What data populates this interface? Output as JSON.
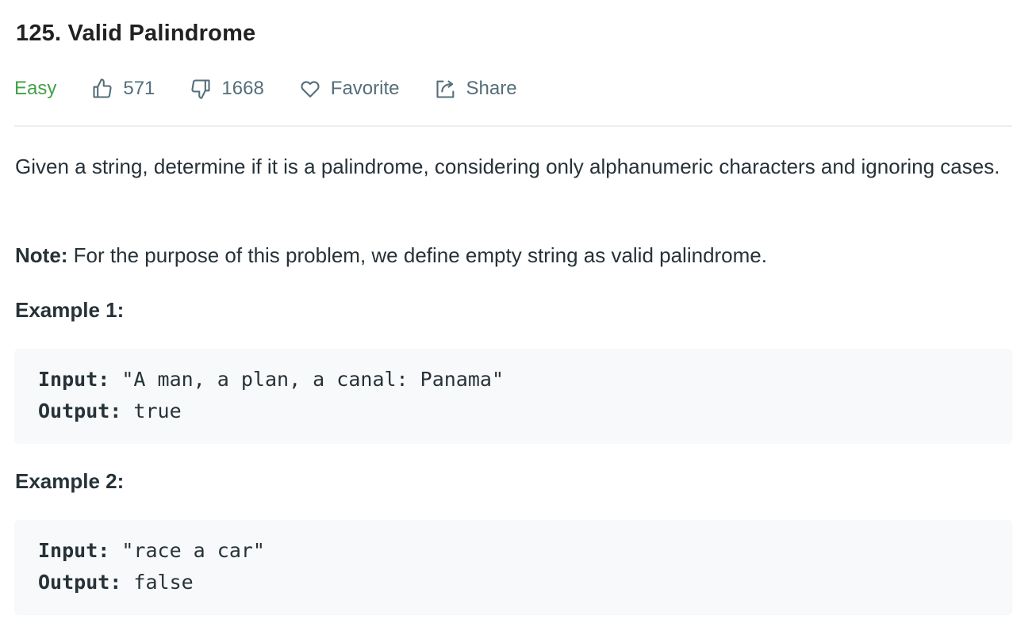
{
  "problem": {
    "title": "125. Valid Palindrome",
    "difficulty": "Easy",
    "likes": "571",
    "dislikes": "1668",
    "favorite_label": "Favorite",
    "share_label": "Share"
  },
  "description": {
    "text": "Given a string, determine if it is a palindrome, considering only alphanumeric characters and ignoring cases.",
    "note_label": "Note:",
    "note_text": " For the purpose of this problem, we define empty string as valid palindrome."
  },
  "examples": [
    {
      "title": "Example 1:",
      "input_label": "Input:",
      "input_value": " \"A man, a plan, a canal: Panama\"",
      "output_label": "Output:",
      "output_value": " true"
    },
    {
      "title": "Example 2:",
      "input_label": "Input:",
      "input_value": " \"race a car\"",
      "output_label": "Output:",
      "output_value": " false"
    }
  ],
  "colors": {
    "difficulty_easy": "#43a047",
    "meta_text": "#546e7a",
    "code_bg": "#f7f9fa"
  },
  "icons": {
    "like": "thumbs-up-icon",
    "dislike": "thumbs-down-icon",
    "favorite": "heart-icon",
    "share": "share-icon"
  }
}
